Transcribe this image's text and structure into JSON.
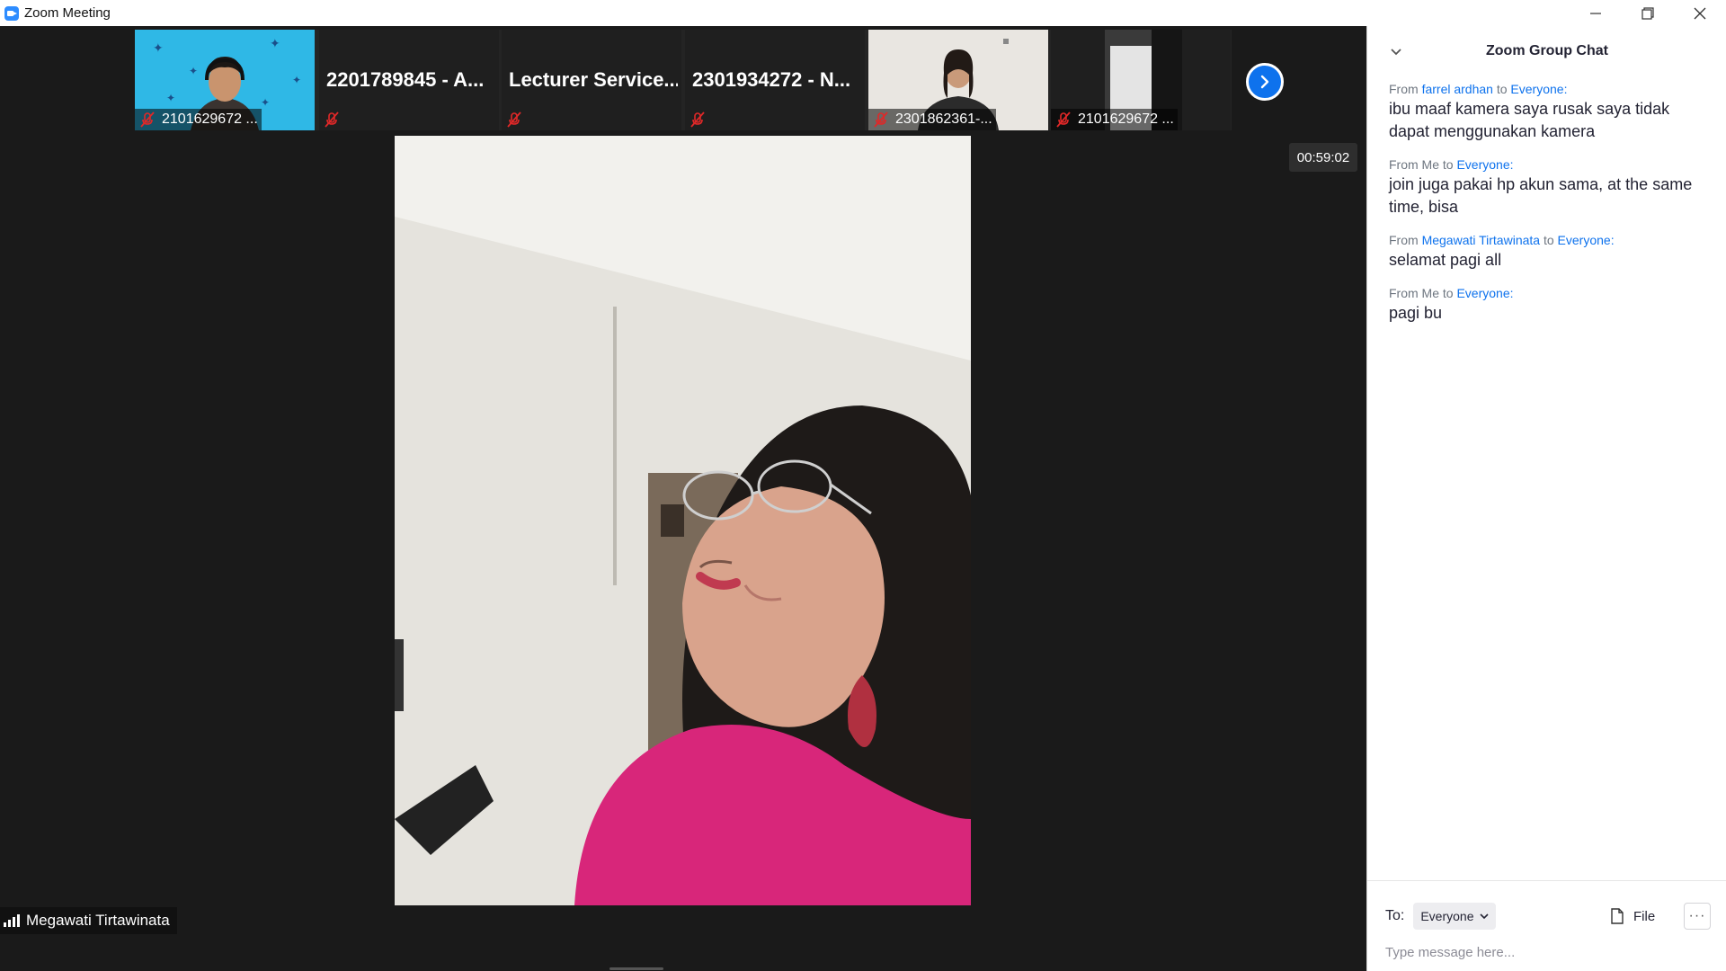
{
  "window": {
    "title": "Zoom Meeting"
  },
  "participants": [
    {
      "label": "2101629672 ...",
      "video": true,
      "muted": true
    },
    {
      "name": "2201789845 - A...",
      "video": false,
      "muted": true
    },
    {
      "name": "Lecturer Service...",
      "video": false,
      "muted": true
    },
    {
      "name": "2301934272 - N...",
      "video": false,
      "muted": true
    },
    {
      "label": "2301862361-...",
      "video": true,
      "muted": true
    },
    {
      "label": "2101629672 ...",
      "video": true,
      "muted": true
    }
  ],
  "timer": "00:59:02",
  "speaker": {
    "name": "Megawati Tirtawinata"
  },
  "chat": {
    "title": "Zoom Group Chat",
    "messages": [
      {
        "from_prefix": "From",
        "sender": "farrel ardhan",
        "to_word": "to",
        "recipient": "Everyone:",
        "text": "ibu maaf kamera saya rusak saya tidak dapat menggunakan kamera"
      },
      {
        "from_prefix": "From Me to",
        "recipient": "Everyone:",
        "text": "join juga pakai hp akun sama, at the same time, bisa"
      },
      {
        "from_prefix": "From",
        "sender": "Megawati Tirtawinata",
        "to_word": "to",
        "recipient": "Everyone:",
        "text": "selamat pagi all"
      },
      {
        "from_prefix": "From Me to",
        "recipient": "Everyone:",
        "text": "pagi bu"
      }
    ],
    "to_label": "To:",
    "to_value": "Everyone",
    "file_label": "File",
    "more_label": "···",
    "input_placeholder": "Type message here..."
  },
  "colors": {
    "accent": "#0e72ed",
    "mute_red": "#e02828",
    "chat_bg": "#ffffff",
    "meeting_bg": "#1a1a1a"
  }
}
